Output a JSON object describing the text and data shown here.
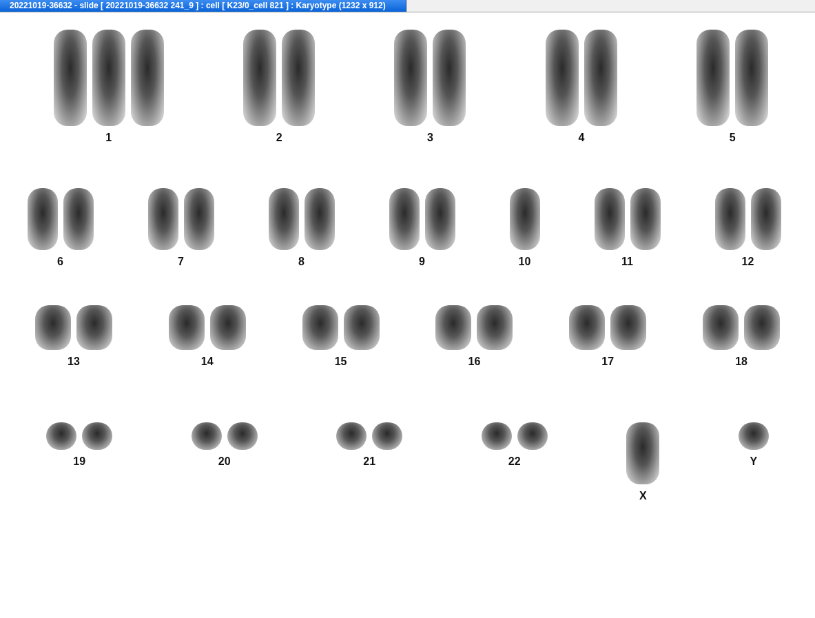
{
  "window": {
    "title": "20221019-36632 - slide [ 20221019-36632 241_9 ] : cell [ K23/0_cell 821 ] : Karyotype  (1232 x 912)"
  },
  "karyotype": {
    "rows": [
      {
        "groups": [
          {
            "label": "1",
            "kind": "triple"
          },
          {
            "label": "2",
            "kind": "pair"
          },
          {
            "label": "3",
            "kind": "pair"
          },
          {
            "label": "4",
            "kind": "pair"
          },
          {
            "label": "5",
            "kind": "pair"
          }
        ]
      },
      {
        "groups": [
          {
            "label": "6",
            "kind": "pair"
          },
          {
            "label": "7",
            "kind": "pair"
          },
          {
            "label": "8",
            "kind": "pair"
          },
          {
            "label": "9",
            "kind": "pair"
          },
          {
            "label": "10",
            "kind": "single"
          },
          {
            "label": "11",
            "kind": "pair"
          },
          {
            "label": "12",
            "kind": "pair"
          }
        ]
      },
      {
        "groups": [
          {
            "label": "13",
            "kind": "pair"
          },
          {
            "label": "14",
            "kind": "pair"
          },
          {
            "label": "15",
            "kind": "pair"
          },
          {
            "label": "16",
            "kind": "pair"
          },
          {
            "label": "17",
            "kind": "pair"
          },
          {
            "label": "18",
            "kind": "pair"
          }
        ]
      },
      {
        "groups": [
          {
            "label": "19",
            "kind": "pair"
          },
          {
            "label": "20",
            "kind": "pair"
          },
          {
            "label": "21",
            "kind": "pair"
          },
          {
            "label": "22",
            "kind": "pair"
          },
          {
            "label": "X",
            "kind": "single"
          },
          {
            "label": "Y",
            "kind": "single"
          }
        ]
      }
    ]
  }
}
